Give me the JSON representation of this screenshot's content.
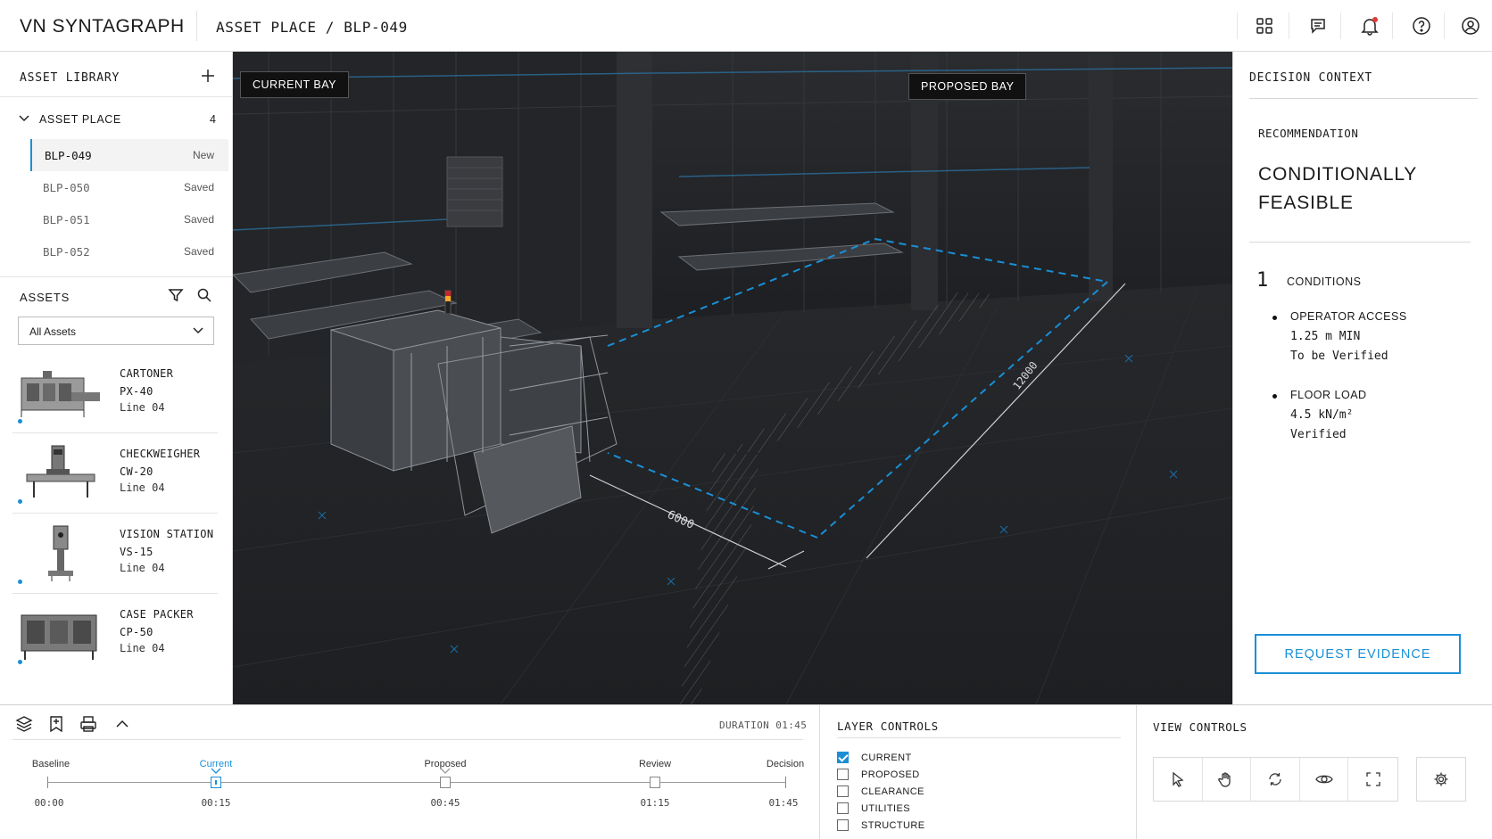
{
  "header": {
    "brand": "VN SYNTAGRAPH",
    "breadcrumb": "ASSET PLACE / BLP-049",
    "icons": [
      "dashboard-icon",
      "chat-icon",
      "bell-icon",
      "help-icon",
      "user-icon"
    ],
    "notification_color": "#e53935"
  },
  "library": {
    "title": "ASSET LIBRARY",
    "folder": {
      "label": "ASSET PLACE",
      "count": "4"
    },
    "items": [
      {
        "id": "BLP-049",
        "status": "New"
      },
      {
        "id": "BLP-050",
        "status": "Saved"
      },
      {
        "id": "BLP-051",
        "status": "Saved"
      },
      {
        "id": "BLP-052",
        "status": "Saved"
      }
    ]
  },
  "assets": {
    "title": "ASSETS",
    "filter_value": "All Assets",
    "cards": [
      {
        "name1": "CARTONER",
        "name2": "PX-40",
        "line": "Line 04"
      },
      {
        "name1": "CHECKWEIGHER",
        "name2": "CW-20",
        "line": "Line 04"
      },
      {
        "name1": "VISION STATION",
        "name2": "VS-15",
        "line": "Line 04"
      },
      {
        "name1": "CASE PACKER",
        "name2": "CP-50",
        "line": "Line 04"
      }
    ]
  },
  "viewport": {
    "current_tag": "CURRENT BAY",
    "proposed_tag": "PROPOSED BAY",
    "dim_width": "6000",
    "dim_length": "12000",
    "accent": "#1a8fd6"
  },
  "decision": {
    "title": "DECISION CONTEXT",
    "rec_label": "RECOMMENDATION",
    "rec_line1": "CONDITIONALLY",
    "rec_line2": "FEASIBLE",
    "conditions_count": "1",
    "conditions_label": "CONDITIONS",
    "conditions": [
      {
        "title": "OPERATOR ACCESS",
        "value": "1.25 m MIN",
        "status": "To be Verified"
      },
      {
        "title": "FLOOR LOAD",
        "value": "4.5 kN/m²",
        "status": "Verified"
      }
    ],
    "button": "REQUEST EVIDENCE"
  },
  "timeline": {
    "duration": "DURATION 01:45",
    "stages": [
      {
        "label": "Baseline",
        "time": "00:00"
      },
      {
        "label": "Current",
        "time": "00:15"
      },
      {
        "label": "Proposed",
        "time": "00:45"
      },
      {
        "label": "Review",
        "time": "01:15"
      },
      {
        "label": "Decision",
        "time": "01:45"
      }
    ],
    "active_stage": "Current"
  },
  "layers": {
    "title": "LAYER CONTROLS",
    "items": [
      {
        "label": "CURRENT",
        "checked": true
      },
      {
        "label": "PROPOSED",
        "checked": false
      },
      {
        "label": "CLEARANCE",
        "checked": false
      },
      {
        "label": "UTILITIES",
        "checked": false
      },
      {
        "label": "STRUCTURE",
        "checked": false
      }
    ]
  },
  "views": {
    "title": "VIEW CONTROLS",
    "tools": [
      "pointer-icon",
      "hand-icon",
      "orbit-icon",
      "eye-icon",
      "fullscreen-icon"
    ],
    "settings": "gear-icon"
  }
}
